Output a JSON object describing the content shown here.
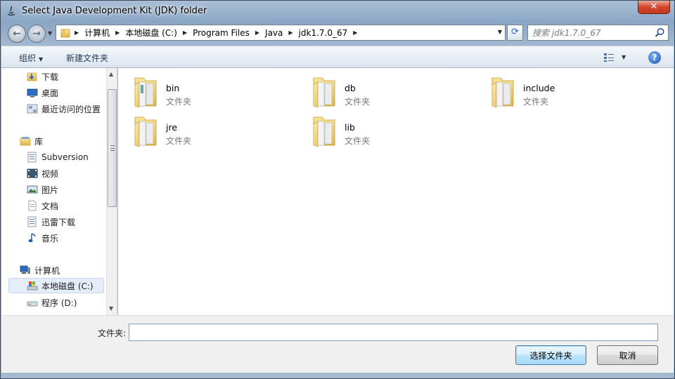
{
  "window": {
    "title": "Select Java Development Kit (JDK) folder",
    "close_label": "✕"
  },
  "address": {
    "crumbs": [
      "计算机",
      "本地磁盘 (C:)",
      "Program Files",
      "Java",
      "jdk1.7.0_67"
    ]
  },
  "search": {
    "placeholder": "搜索 jdk1.7.0_67"
  },
  "toolbar": {
    "organize_label": "组织",
    "new_folder_label": "新建文件夹",
    "help_label": "?"
  },
  "nav": {
    "favorites": [
      {
        "label": "下载",
        "icon": "download-folder-icon"
      },
      {
        "label": "桌面",
        "icon": "desktop-icon"
      },
      {
        "label": "最近访问的位置",
        "icon": "recent-places-icon"
      }
    ],
    "libraries_label": "库",
    "libraries": [
      {
        "label": "Subversion",
        "icon": "library-icon"
      },
      {
        "label": "视频",
        "icon": "video-icon"
      },
      {
        "label": "图片",
        "icon": "picture-icon"
      },
      {
        "label": "文档",
        "icon": "document-icon"
      },
      {
        "label": "迅雷下载",
        "icon": "library-icon"
      },
      {
        "label": "音乐",
        "icon": "music-icon"
      }
    ],
    "computer_label": "计算机",
    "drives": [
      {
        "label": "本地磁盘 (C:)",
        "icon": "system-drive-icon",
        "selected": true
      },
      {
        "label": "程序 (D:)",
        "icon": "drive-icon",
        "selected": false
      }
    ]
  },
  "files": [
    {
      "name": "bin",
      "type": "文件夹"
    },
    {
      "name": "db",
      "type": "文件夹"
    },
    {
      "name": "include",
      "type": "文件夹"
    },
    {
      "name": "jre",
      "type": "文件夹"
    },
    {
      "name": "lib",
      "type": "文件夹"
    }
  ],
  "footer": {
    "folder_label": "文件夹:",
    "folder_value": "",
    "ok_label": "选择文件夹",
    "cancel_label": "取消"
  }
}
